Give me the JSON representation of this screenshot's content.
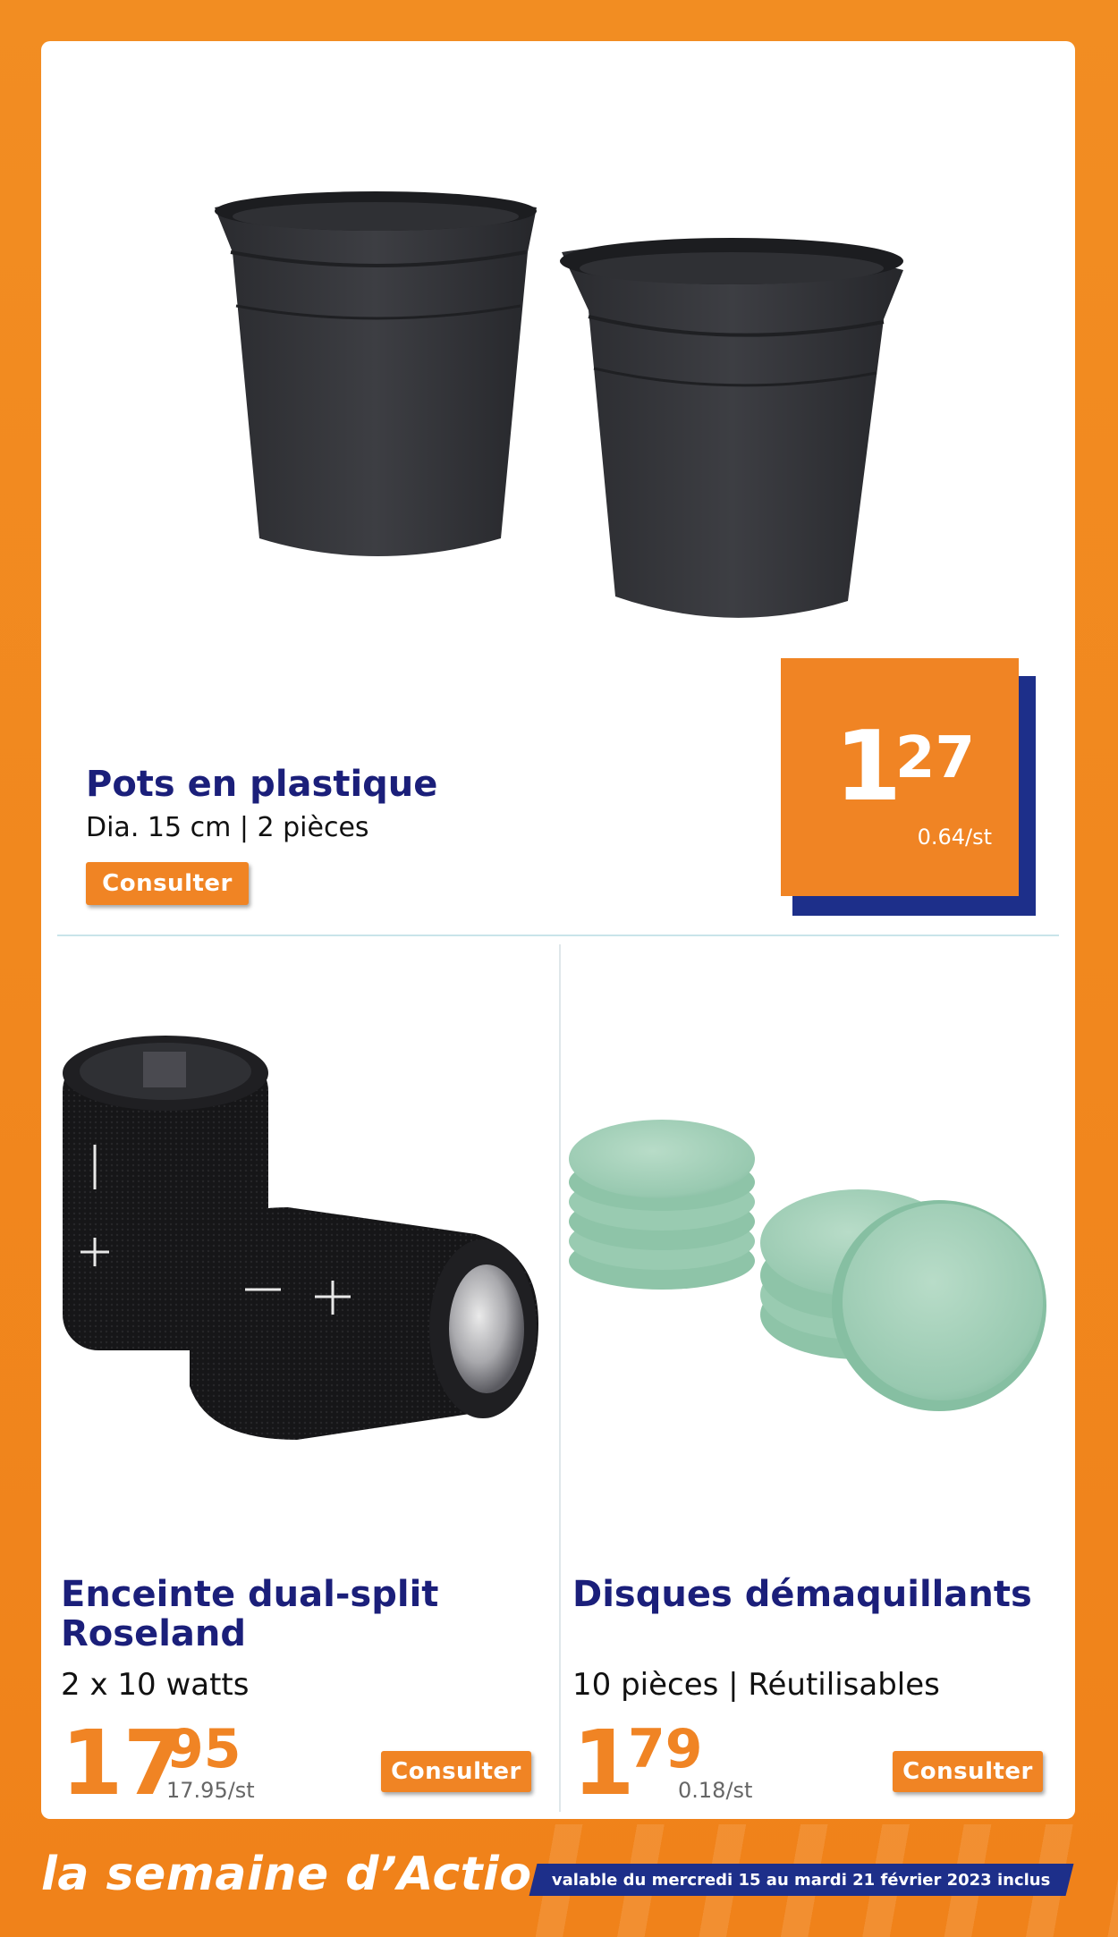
{
  "products": [
    {
      "name": "Pots en plastique",
      "details": "Dia. 15 cm | 2 pièces",
      "button": "Consulter",
      "price_int": "1",
      "price_dec": "27",
      "unit_price": "0.64/st"
    },
    {
      "name_line1": "Enceinte dual-split",
      "name_line2": "Roseland",
      "details": "2 x 10 watts",
      "button": "Consulter",
      "price_int": "17",
      "price_dec": "95",
      "unit_price": "17.95/st"
    },
    {
      "name": "Disques démaquillants",
      "details": "10 pièces | Réutilisables",
      "button": "Consulter",
      "price_int": "1",
      "price_dec": "79",
      "unit_price": "0.18/st"
    }
  ],
  "footer": {
    "brand_text": "la semaine d’Action",
    "validity": "valable du mercredi 15 au mardi 21 février 2023 inclus"
  },
  "colors": {
    "accent_orange": "#f08424",
    "navy": "#1b1f7a"
  }
}
